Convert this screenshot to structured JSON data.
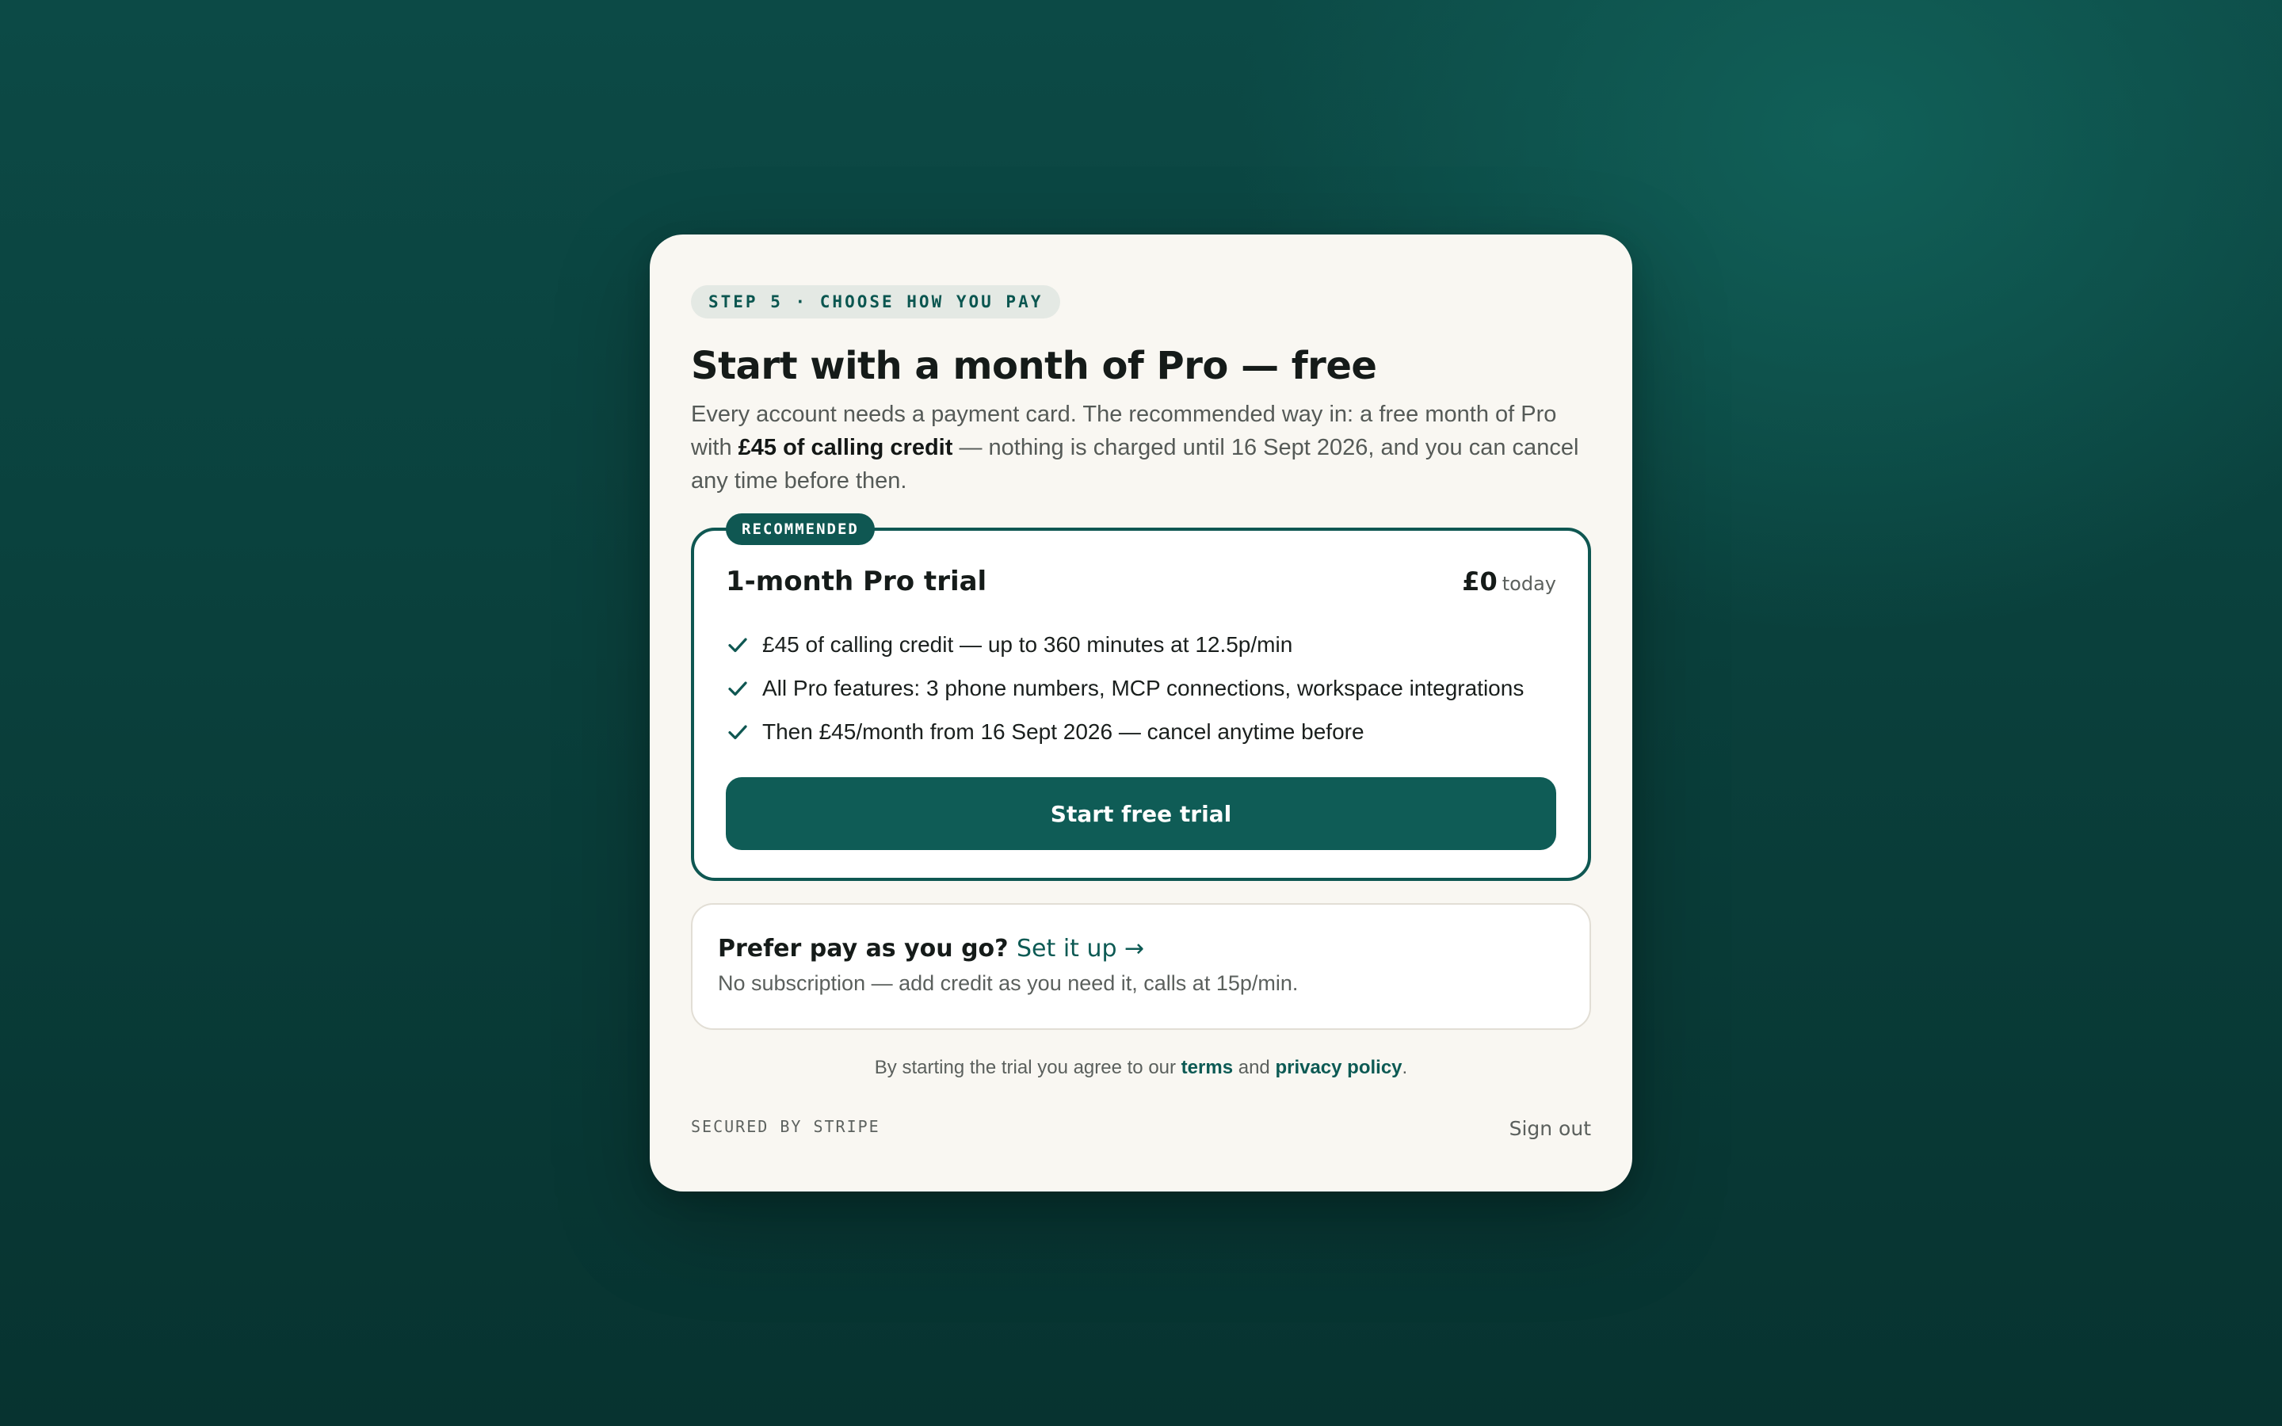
{
  "step": {
    "label": "STEP 5 · CHOOSE HOW YOU PAY"
  },
  "header": {
    "title": "Start with a month of Pro — free",
    "intro_before": "Every account needs a payment card. The recommended way in: a free month of Pro with ",
    "intro_bold": "£45 of calling credit",
    "intro_after": " — nothing is charged until 16 Sept 2026, and you can cancel any time before then."
  },
  "trial": {
    "badge": "RECOMMENDED",
    "name": "1-month Pro trial",
    "price": "£0",
    "price_note": "today",
    "features": [
      {
        "icon": "check-icon",
        "text": "£45 of calling credit — up to 360 minutes at 12.5p/min"
      },
      {
        "icon": "check-icon",
        "text": "All Pro features: 3 phone numbers, MCP connections, workspace integrations"
      },
      {
        "icon": "check-icon",
        "text": "Then £45/month from 16 Sept 2026 — cancel anytime before"
      }
    ],
    "cta": "Start free trial"
  },
  "payg": {
    "title": "Prefer pay as you go?",
    "link": "Set it up →",
    "description": "No subscription — add credit as you need it, calls at 15p/min."
  },
  "legal": {
    "before": "By starting the trial you agree to our ",
    "terms": "terms",
    "and": " and ",
    "privacy": "privacy policy",
    "end": "."
  },
  "footer": {
    "secured": "SECURED BY STRIPE",
    "sign_out": "Sign out"
  },
  "colors": {
    "accent": "#0f5c56",
    "card_background": "#f9f7f2",
    "page_background": "#0a403c"
  }
}
